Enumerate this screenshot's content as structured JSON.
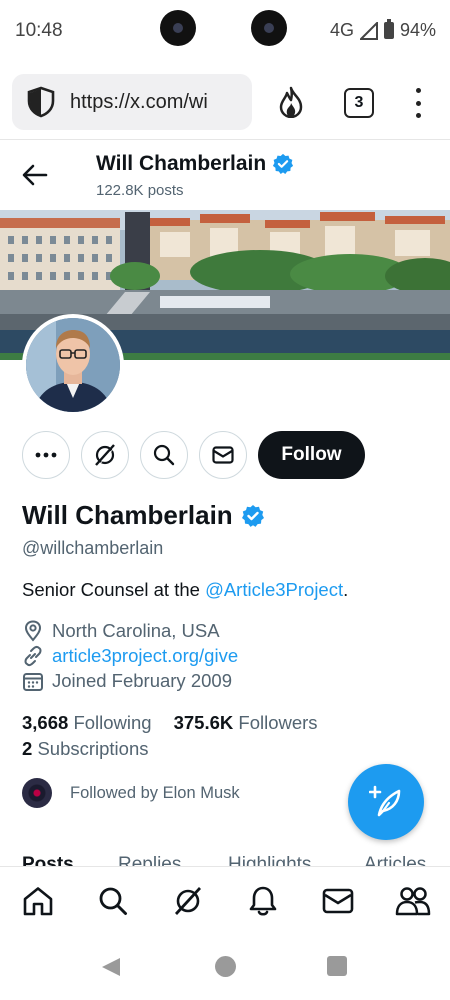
{
  "status": {
    "time": "10:48",
    "network": "4G",
    "battery": "94%"
  },
  "browser": {
    "url": "https://x.com/wi",
    "tab_count": "3"
  },
  "header": {
    "name": "Will Chamberlain",
    "posts": "122.8K posts"
  },
  "profile": {
    "display_name": "Will Chamberlain",
    "handle": "@willchamberlain",
    "bio_prefix": "Senior Counsel at the ",
    "bio_mention": "@Article3Project",
    "bio_suffix": ".",
    "location": "North Carolina, USA",
    "website": "article3project.org/give",
    "joined": "Joined February 2009",
    "following_count": "3,668",
    "following_label": "Following",
    "followers_count": "375.6K",
    "followers_label": "Followers",
    "subscriptions_count": "2",
    "subscriptions_label": "Subscriptions",
    "followed_by": "Followed by Elon Musk",
    "follow_button": "Follow"
  },
  "tabs": [
    {
      "label": "Posts"
    },
    {
      "label": "Replies"
    },
    {
      "label": "Highlights"
    },
    {
      "label": "Articles"
    }
  ],
  "colors": {
    "accent": "#1d9bf0",
    "primary_text": "#0f1419",
    "secondary_text": "#536471"
  }
}
